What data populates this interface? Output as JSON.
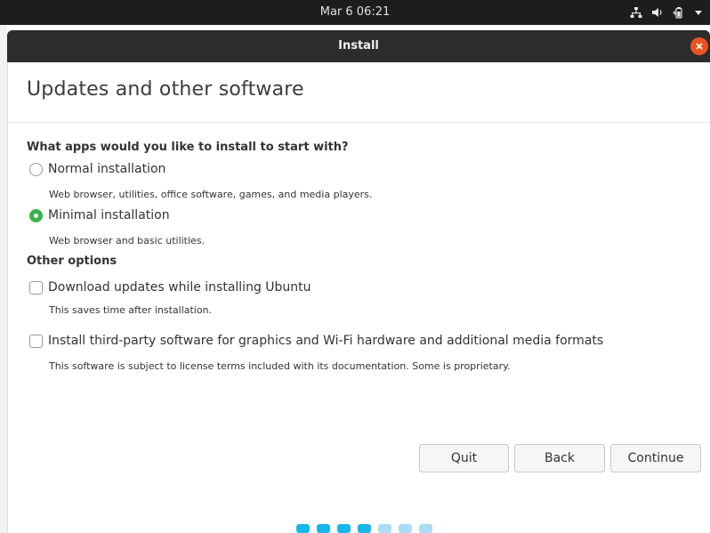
{
  "topbar": {
    "clock": "Mar 6  06:21",
    "icons": [
      "network-icon",
      "volume-icon",
      "battery-icon",
      "chevron-down-icon"
    ]
  },
  "window": {
    "title": "Install",
    "close_color": "#e95420"
  },
  "page": {
    "title": "Updates and other software",
    "question": "What apps would you like to install to start with?",
    "install_options": [
      {
        "label": "Normal installation",
        "description": "Web browser, utilities, office software, games, and media players.",
        "checked": false
      },
      {
        "label": "Minimal installation",
        "description": "Web browser and basic utilities.",
        "checked": true
      }
    ],
    "other_options_title": "Other options",
    "other_options": [
      {
        "label": "Download updates while installing Ubuntu",
        "description": "This saves time after installation.",
        "checked": false
      },
      {
        "label": "Install third-party software for graphics and Wi-Fi hardware and additional media formats",
        "description": "This software is subject to license terms included with its documentation. Some is proprietary.",
        "checked": false
      }
    ]
  },
  "buttons": {
    "quit": "Quit",
    "back": "Back",
    "continue": "Continue"
  },
  "progress": {
    "total_steps": 7,
    "completed_steps": 4,
    "active_color": "#19b6ee",
    "inactive_color": "#a8ddf3"
  },
  "colors": {
    "accent_green": "#38b44a",
    "topbar": "#1d1d1d",
    "titlebar": "#2c2c2c"
  }
}
